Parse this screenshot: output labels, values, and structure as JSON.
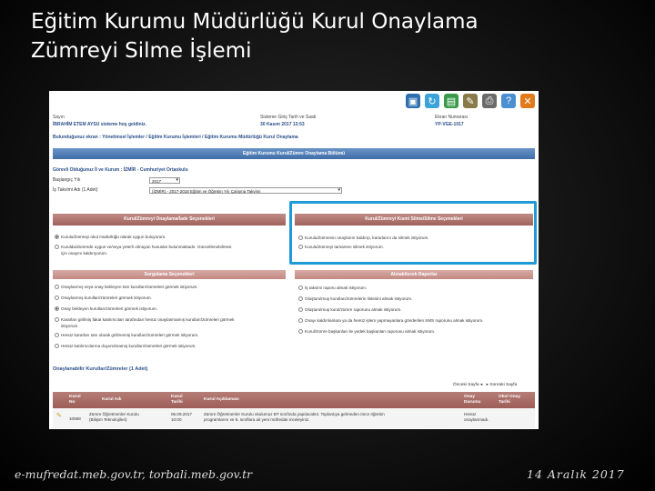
{
  "slide": {
    "title_line1": "Eğitim Kurumu Müdürlüğü Kurul Onaylama",
    "title_line2": "Zümreyi Silme İşlemi",
    "footer_left": "e-mufredat.meb.gov.tr, torbali.meb.gov.tr",
    "footer_right": "14 Aralık 2017"
  },
  "toolbar": {
    "icons": [
      "save-icon",
      "refresh-icon",
      "delete-icon",
      "clear-icon",
      "print-icon",
      "help-icon",
      "close-icon"
    ],
    "colors": [
      "#2f6fb0",
      "#3aa3d8",
      "#3a9a4a",
      "#8a7a4a",
      "#6a6a6a",
      "#4a8fd0",
      "#e07a1a"
    ]
  },
  "info": {
    "user_label": "Sayın",
    "user_value": "İBRAHİM ETEM AYSU sisteme hoş geldiniz.",
    "date_label": "Sisteme Giriş Tarih ve Saati",
    "date_value": "30 Kasım 2017 13:53",
    "screen_label": "Ekran Numarası",
    "screen_value": "YP-VGE-1017"
  },
  "breadcrumb": "Bulunduğunuz ekran : Yönetimsel İşlemler / Eğitim Kurumu İşlemleri / Eğitim Kurumu Müdürlüğü Kurul Onaylama",
  "section_title": "Eğitim Kurumu Kurul/Zümre Onaylama Bölümü",
  "duty": "Görevli Olduğunuz İl ve Kurum : İZMİR - Cumhuriyet Ortaokulu",
  "start_year_label": "Başlangıç Yılı",
  "start_year_value": "2017",
  "calendar_label": "İş Takvimi Adı (1 Adet)",
  "calendar_value": "(İZMİR) - 2017-2018 Eğitim ve Öğretim Yılı Çalışma Takvimi",
  "approve_panel": {
    "title": "Kurul/Zümreyi Onaylama/İade Seçenekleri",
    "opt1": "Kurulu/Zümreyi okul müdürlüğü olarak uygun buluyorum.",
    "opt2a": "Kurulda/Zümrede uygun ve/veya yeterli olmayan hususlar bulunmaktadır. Güncellenebilmesi",
    "opt2b": "için onayını kaldırıyorum."
  },
  "delete_panel": {
    "title": "Kurul/Zümreyi Kısmi Silme/Silme Seçenekleri",
    "opt1": "Kurulu/Zümrenin onaylarını kaldırıp, kararlarını da silmek istiyorum.",
    "opt2": "Kurulu/Zümreyi tamamen silmek istiyorum."
  },
  "query_panel": {
    "title": "Sorgulama Seçenekleri",
    "opts": [
      "Onaylanmış veya onay bekleyen tüm kurulları/zümreleri görmek istiyorum.",
      "Onaylanmış kurulları/zümreleri görmek istiyorum.",
      "Onay bekleyen kurulları/zümreleri görmek istiyorum.",
      "Kararları girilmiş fakat katılımcıları tarafından henüz onaylanmamış kurulları/zümreleri görmek",
      "istiyorum.",
      "Henüz kararları tam olarak girilmemiş kurulları/zümreleri görmek istiyorum.",
      "Henüz katılımcılarına duyurulmamış kurulları/zümreleri görmek istiyorum."
    ]
  },
  "reports_panel": {
    "title": "Alınabilecek Raporlar",
    "opts": [
      "İş takvimi raporu almak istiyorum.",
      "Oluşturulmuş kurulları/zümrelerin listesini almak istiyorum.",
      "Oluşturulmuş kurul/zümre raporunu almak istiyorum.",
      "Onayı kaldırılanlara ya da henüz işlem yapmayanlara gönderilen SMS raporunu almak istiyorum.",
      "Kurul/zümre başkanları ile yedek başkanları raporunu almak istiyorum."
    ]
  },
  "list": {
    "title": "Onaylanabilir Kurullar/Zümreler (1 Adet)",
    "prev": "Önceki Sayfa",
    "next": "Sonraki Sayfa",
    "headers": {
      "no": "Kurul No",
      "name": "Kurul Adı",
      "date": "Kurul Tarihi",
      "desc": "Kurul Açıklaması",
      "approval": "Onay Durumu",
      "principal": "Okul Onay Tarihi"
    },
    "row": {
      "no": "10568",
      "name_a": "Zümre Öğretmenler Kurulu",
      "name_b": "(Bilişim Teknolojileri)",
      "date_a": "06.09.2017",
      "date_b": "10:00",
      "desc_a": "Zümre Öğretmenler Kurulu okulumuz BT sınıfında yapılacaktır. Toplantıya gelmeden önce öğretim",
      "desc_b": "programlarını ve 5. sınıflara ait yeni müfredatı inceleyiniz.",
      "approval_a": "Henüz",
      "approval_b": "onaylanmadı."
    }
  }
}
